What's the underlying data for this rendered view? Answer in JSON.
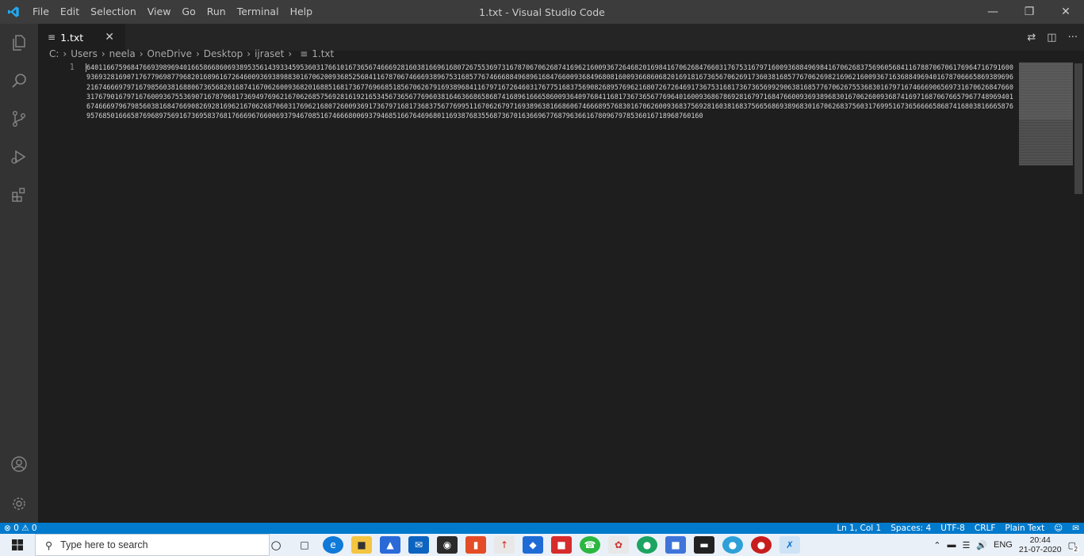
{
  "titlebar": {
    "menu": [
      "File",
      "Edit",
      "Selection",
      "View",
      "Go",
      "Run",
      "Terminal",
      "Help"
    ],
    "window_title": "1.txt - Visual Studio Code"
  },
  "tab": {
    "label": "1.txt"
  },
  "breadcrumb": [
    "C:",
    "Users",
    "neela",
    "OneDrive",
    "Desktop",
    "ijraset",
    "1.txt"
  ],
  "editor": {
    "line_number": "1",
    "content": "6401166759684766939896940166586686069389535614393345953603176610167365674666928160381669616807267553697316787067062687416962160093672646820169841670626847660317675316797160093688496984167062683756960568411678870670617696471679160093693281690717677969877968201689616726460093693898830167062009368525684116787067466693896753168577674666884968961684766009368496808160093668606820169181673656706269173603816857767062698216962160093671636884969401678706665869389696216746669797167985603816880673656820168741670626009368201688516817367769668518567062679169389684116797167264603176775168375690826895769621680726726469173675316817367365699290638168577670626755368301679716746669065697316706268476603176790167971676009367553690716787068173694976962167062685756928161921653456736567769603816463668658687416896166658600936409768411681736736567769640160093686786928167971684766009369389683016706260093687416971687067665796774896940167466697967985603816847669082692816962167062687060317696216807260093691736797168173683756776995116706267971693896381668606746668957683016706260093683756928160381683756656869389683016706268375603176995167365666658687416803816665876957685016665876968975691673695837681766696766006937946708516746668006937946851667646968011693876835568736701636696776879636616780967978536016718968760160"
  },
  "statusbar": {
    "problems": "⊗ 0 ⚠ 0",
    "position": "Ln 1, Col 1",
    "spaces": "Spaces: 4",
    "encoding": "UTF-8",
    "eol": "CRLF",
    "language": "Plain Text"
  },
  "taskbar": {
    "search_placeholder": "Type here to search",
    "lang": "ENG",
    "time": "20:44",
    "date": "21-07-2020",
    "notification_count": "2"
  },
  "colors": {
    "accent": "#007acc",
    "titlebar": "#3c3c3c",
    "activitybar": "#333333",
    "editor_bg": "#1e1e1e"
  }
}
